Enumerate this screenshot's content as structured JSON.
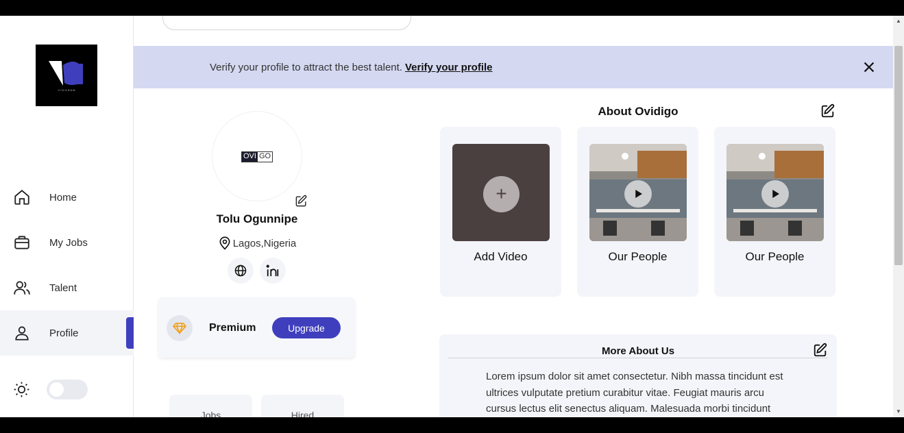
{
  "banner": {
    "message": "Verify your profile to attract the best talent.",
    "link": "Verify your profile"
  },
  "sidebar": {
    "items": [
      {
        "label": "Home",
        "icon": "home-icon"
      },
      {
        "label": "My Jobs",
        "icon": "briefcase-icon"
      },
      {
        "label": "Talent",
        "icon": "users-icon"
      },
      {
        "label": "Profile",
        "icon": "user-icon",
        "active": true
      }
    ],
    "theme_toggle": {
      "icon": "sun-icon",
      "on": false
    }
  },
  "profile": {
    "logo_text_dark": "OVI",
    "logo_text_light": "GO",
    "name": "Tolu Ogunnipe",
    "location": "Lagos,Nigeria",
    "socials": [
      "globe-icon",
      "linkedin-icon"
    ],
    "premium_label": "Premium",
    "upgrade_label": "Upgrade",
    "stats": [
      "Jobs",
      "Hired"
    ]
  },
  "about": {
    "title": "About Ovidigo",
    "videos": [
      {
        "label": "Add Video",
        "type": "add"
      },
      {
        "label": "Our People",
        "type": "video"
      },
      {
        "label": "Our People",
        "type": "video"
      }
    ]
  },
  "more_about": {
    "title": "More About Us",
    "text": "Lorem ipsum dolor sit amet consectetur. Nibh massa tincidunt est ultrices vulputate pretium curabitur vitae. Feugiat mauris arcu cursus lectus elit senectus aliquam. Malesuada morbi tincidunt"
  },
  "colors": {
    "accent": "#3f3fbe",
    "banner_bg": "#d4d8f1",
    "card_bg": "#f4f5fa"
  }
}
